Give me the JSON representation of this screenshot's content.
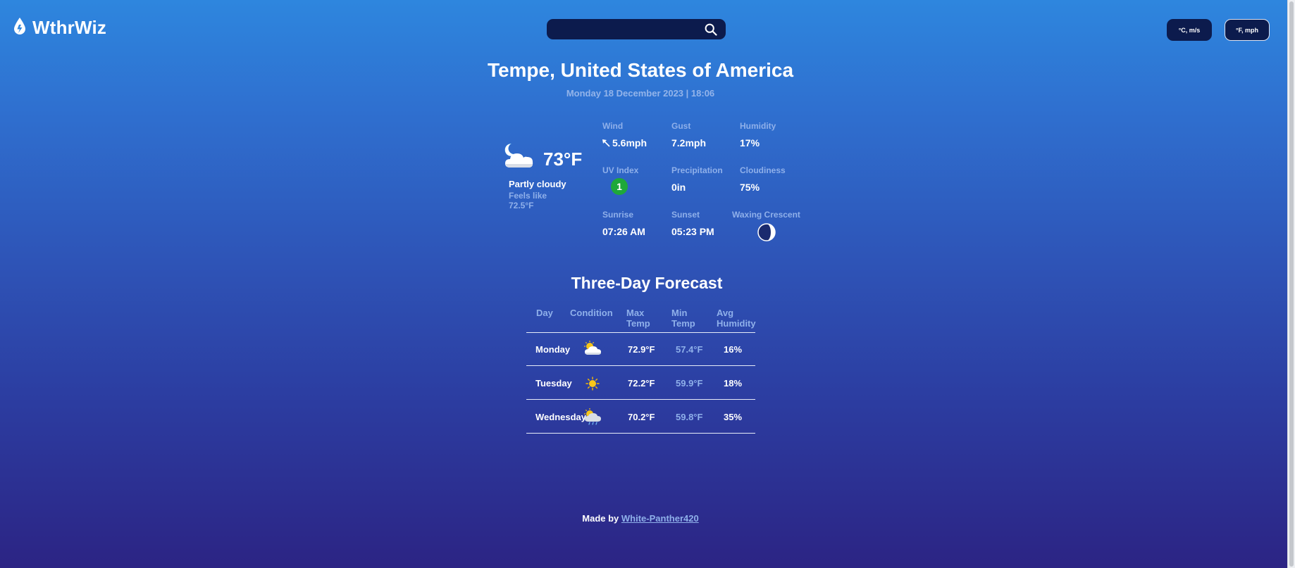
{
  "app": {
    "name": "WthrWiz",
    "logo_icon": "drop-icon"
  },
  "search": {
    "value": "",
    "placeholder": "",
    "icon": "search-icon"
  },
  "units": {
    "metric_label": "°C, m/s",
    "imperial_label": "°F, mph"
  },
  "location": {
    "title": "Tempe, United States of America",
    "datetime": "Monday 18 December 2023 | 18:06"
  },
  "current": {
    "icon": "partly-cloudy-night-icon",
    "temperature": "73°F",
    "condition": "Partly cloudy",
    "feels_like_label": "Feels like",
    "feels_like_value": "72.5°F",
    "stats": {
      "wind": {
        "label": "Wind",
        "value": "5.6mph",
        "icon": "wind-direction-arrow-icon"
      },
      "gust": {
        "label": "Gust",
        "value": "7.2mph"
      },
      "humidity": {
        "label": "Humidity",
        "value": "17%"
      },
      "uv": {
        "label": "UV Index",
        "value": "1",
        "color": "#1ea83a"
      },
      "precipitation": {
        "label": "Precipitation",
        "value": "0in"
      },
      "cloudiness": {
        "label": "Cloudiness",
        "value": "75%"
      },
      "sunrise": {
        "label": "Sunrise",
        "value": "07:26 AM"
      },
      "sunset": {
        "label": "Sunset",
        "value": "05:23 PM"
      },
      "moon": {
        "label": "Waxing Crescent",
        "icon": "moon-phase-icon"
      }
    }
  },
  "forecast": {
    "title": "Three-Day Forecast",
    "headers": {
      "day": "Day",
      "condition": "Condition",
      "max_temp_1": "Max",
      "max_temp_2": "Temp",
      "min_temp_1": "Min",
      "min_temp_2": "Temp",
      "avg_humidity_1": "Avg",
      "avg_humidity_2": "Humidity"
    },
    "rows": [
      {
        "day": "Monday",
        "icon": "partly-cloudy-icon",
        "max": "72.9°F",
        "min": "57.4°F",
        "humidity": "16%"
      },
      {
        "day": "Tuesday",
        "icon": "sunny-icon",
        "max": "72.2°F",
        "min": "59.9°F",
        "humidity": "18%"
      },
      {
        "day": "Wednesday",
        "icon": "patchy-rain-icon",
        "max": "70.2°F",
        "min": "59.8°F",
        "humidity": "35%"
      }
    ]
  },
  "footer": {
    "prefix": "Made by",
    "author_link": "White-Panther420"
  },
  "colors": {
    "accent_label": "#8fb0ea",
    "panel": "#0c1b4d",
    "uv_low": "#1ea83a"
  }
}
